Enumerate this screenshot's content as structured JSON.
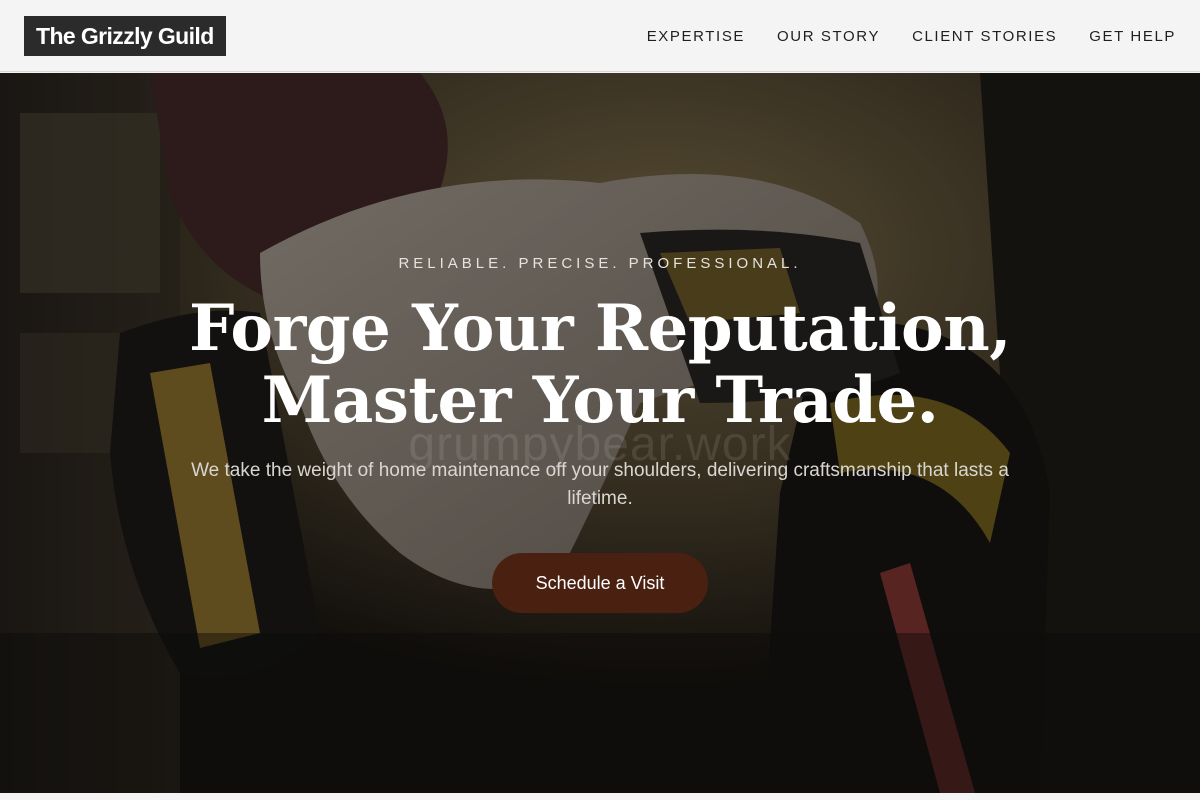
{
  "header": {
    "logo_text": "The Grizzly Guild",
    "nav": [
      {
        "label": "EXPERTISE"
      },
      {
        "label": "OUR STORY"
      },
      {
        "label": "CLIENT STORIES"
      },
      {
        "label": "GET HELP"
      }
    ]
  },
  "hero": {
    "eyebrow": "RELIABLE. PRECISE. PROFESSIONAL.",
    "headline_line1": "Forge Your Reputation,",
    "headline_line2": "Master Your Trade.",
    "subtext": "We take the weight of home maintenance off your shoulders, delivering craftsmanship that lasts a lifetime.",
    "cta_label": "Schedule a Visit",
    "watermark": "grumpybear.work",
    "background_image": "hand-holding-cordless-drill-in-tool-belt"
  },
  "colors": {
    "header_bg": "#f4f4f4",
    "logo_bg": "#2b2b2b",
    "nav_text": "#1f1f1f",
    "cta_bg": "#4a2110",
    "hero_text": "#ffffff"
  }
}
